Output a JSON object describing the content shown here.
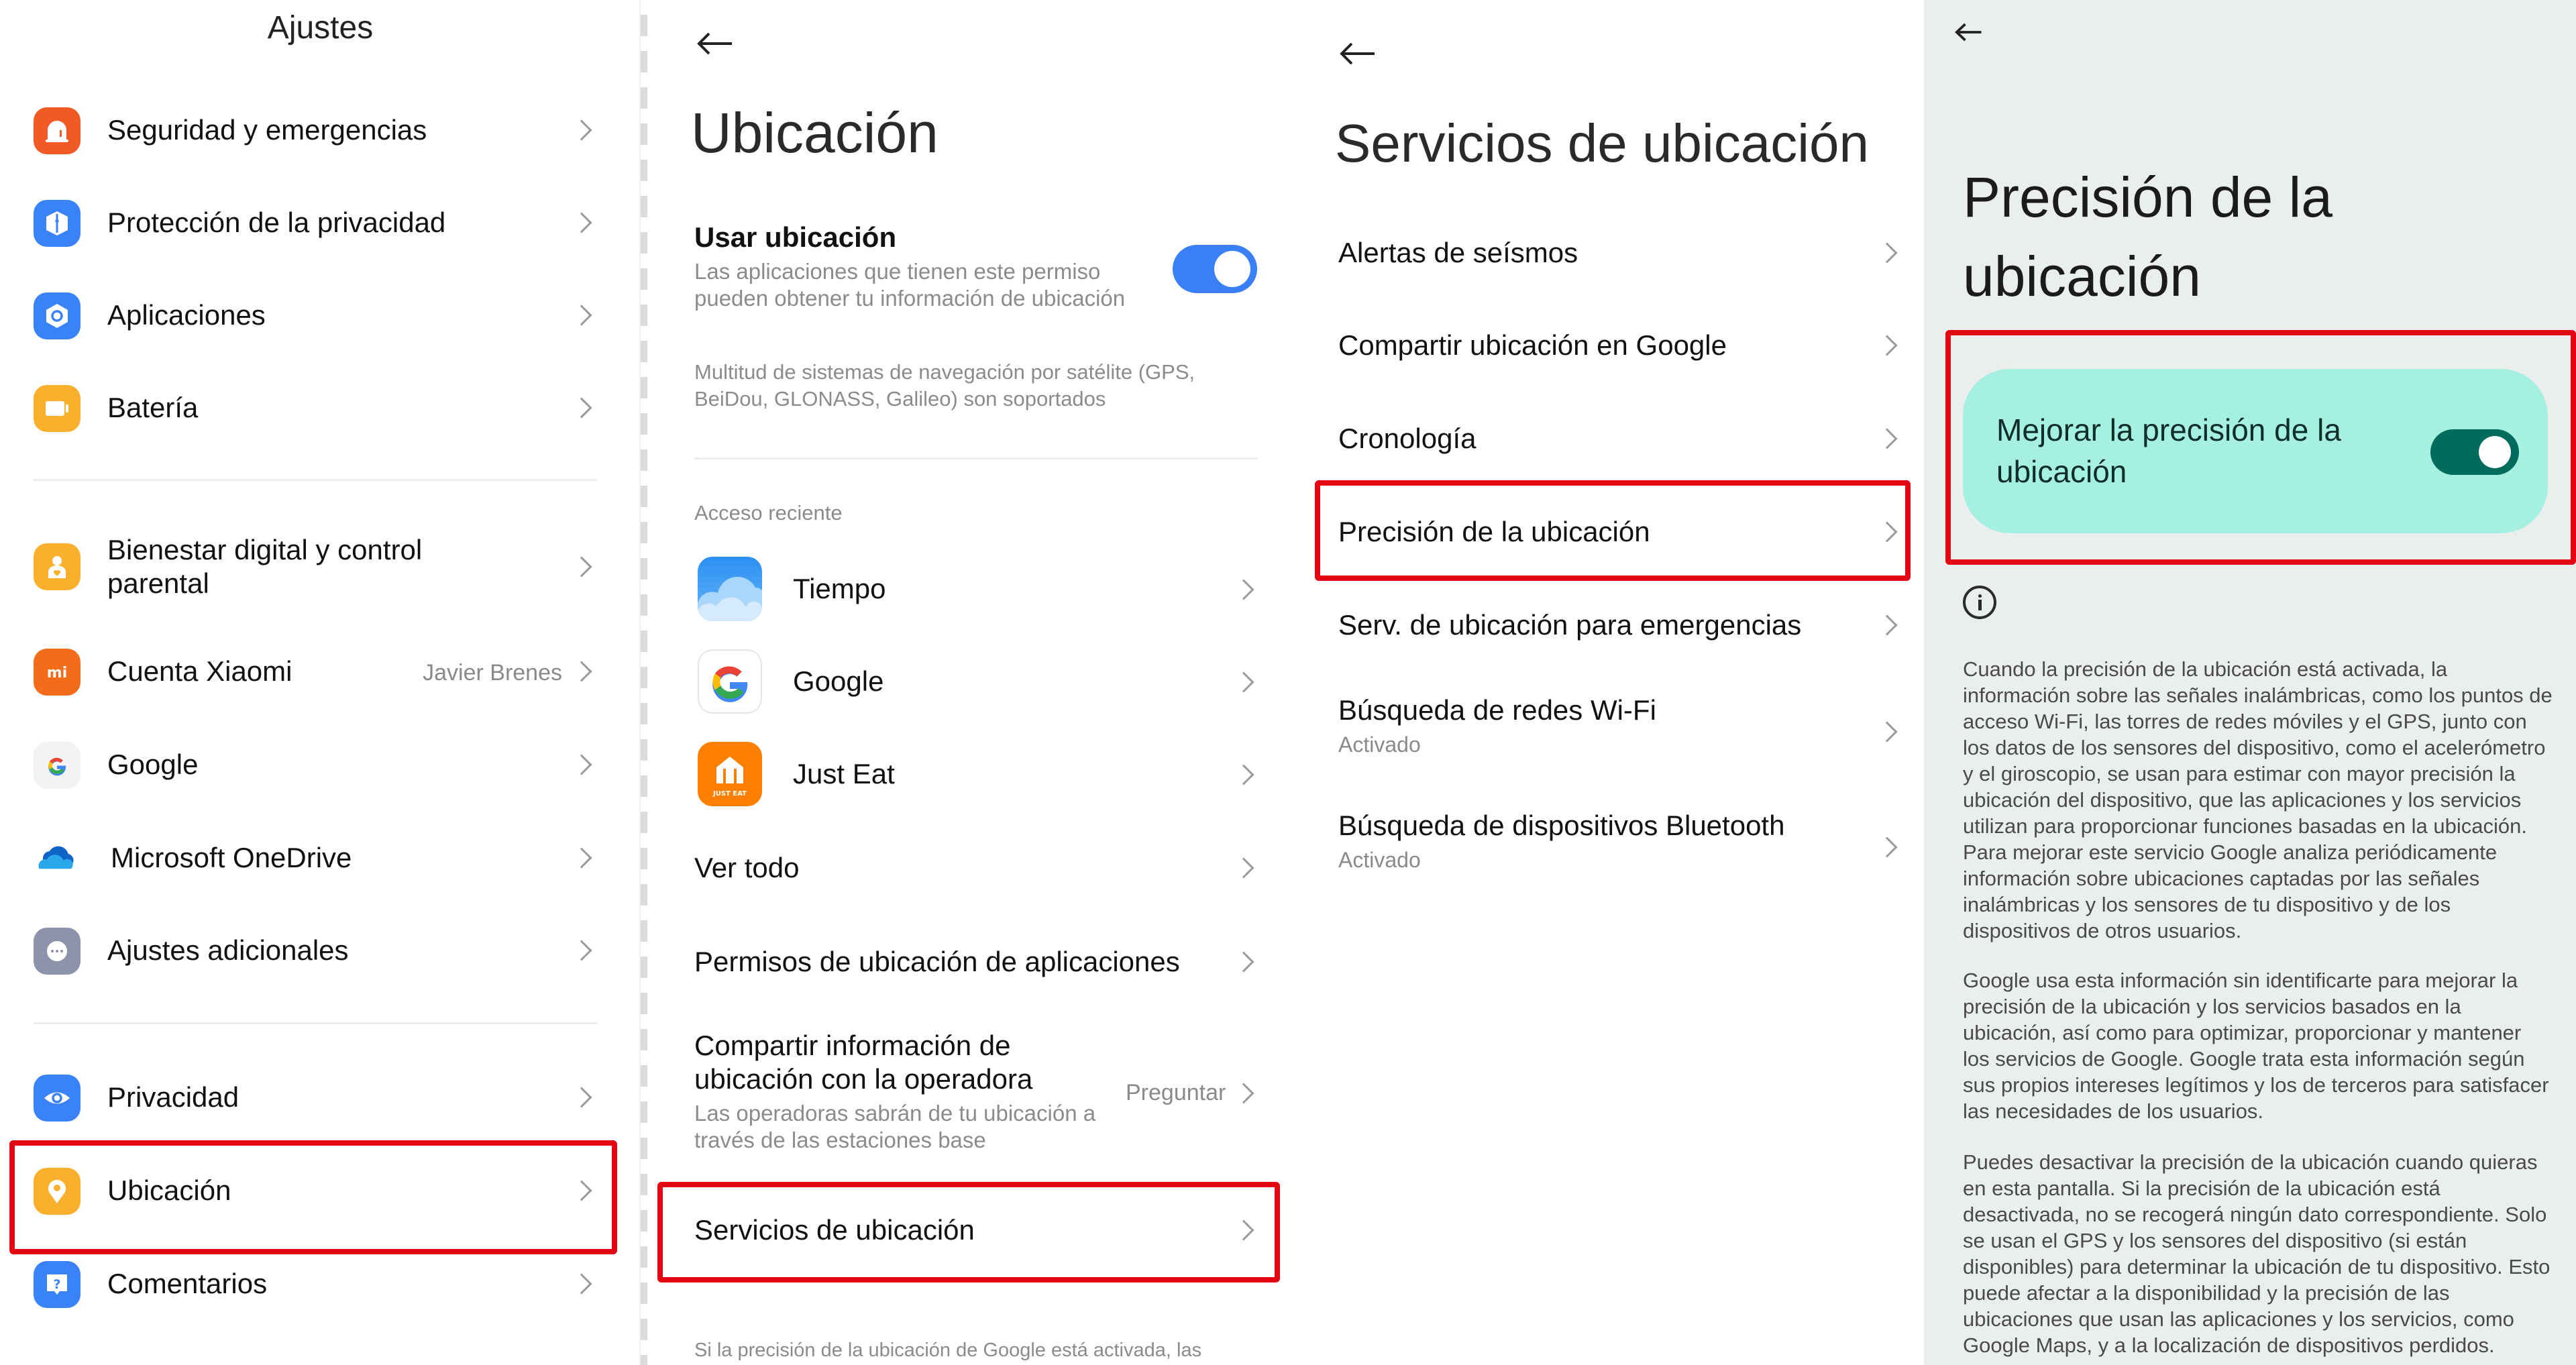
{
  "panels": {
    "settings": {
      "title": "Ajustes",
      "items": [
        {
          "label": "Seguridad y emergencias",
          "icon": "siren-icon",
          "color": "#f15a24"
        },
        {
          "label": "Protección de la privacidad",
          "icon": "privacy-shield-icon",
          "color": "#3a82f7"
        },
        {
          "label": "Aplicaciones",
          "icon": "apps-hexagon-icon",
          "color": "#3a82f7"
        },
        {
          "label": "Batería",
          "icon": "battery-icon",
          "color": "#fbb02d"
        },
        {
          "label": "Bienestar digital y control parental",
          "label_line1": "Bienestar digital y control",
          "label_line2": "parental",
          "icon": "wellbeing-icon",
          "color": "#fbb02d"
        },
        {
          "label": "Cuenta Xiaomi",
          "value": "Javier Brenes",
          "icon": "xiaomi-account-icon",
          "color": "#f26c1a"
        },
        {
          "label": "Google",
          "icon": "google-icon",
          "color": "#f3f3f3"
        },
        {
          "label": "Microsoft OneDrive",
          "icon": "onedrive-icon",
          "color": "#1e88e5"
        },
        {
          "label": "Ajustes adicionales",
          "icon": "more-dots-icon",
          "color": "#8d93ab"
        },
        {
          "label": "Privacidad",
          "icon": "eye-icon",
          "color": "#3a82f7"
        },
        {
          "label": "Ubicación",
          "icon": "location-pin-icon",
          "color": "#fbb02d",
          "highlighted": true
        },
        {
          "label": "Comentarios",
          "icon": "feedback-icon",
          "color": "#3a82f7"
        }
      ]
    },
    "location": {
      "back_icon": "back-arrow-icon",
      "title": "Ubicación",
      "use_location": {
        "label": "Usar ubicación",
        "description_line1": "Las aplicaciones que tienen este permiso",
        "description_line2": "pueden obtener tu información de ubicación",
        "enabled": true,
        "toggle_color": "#3a7ff6"
      },
      "gnss_note_line1": "Multitud de sistemas de navegación por satélite (GPS,",
      "gnss_note_line2": "BeiDou, GLONASS, Galileo) son soportados",
      "recent_access_header": "Acceso reciente",
      "recent_apps": [
        {
          "label": "Tiempo",
          "icon": "weather-app-icon"
        },
        {
          "label": "Google",
          "icon": "google-app-icon"
        },
        {
          "label": "Just Eat",
          "icon": "just-eat-app-icon",
          "icon_text": "JUST EAT"
        }
      ],
      "see_all": "Ver todo",
      "app_permissions": "Permisos de ubicación de aplicaciones",
      "carrier_share": {
        "label_line1": "Compartir información de",
        "label_line2": "ubicación con la operadora",
        "description_line1": "Las operadoras sabrán de tu ubicación a",
        "description_line2": "través de las estaciones base",
        "value": "Preguntar"
      },
      "location_services": {
        "label": "Servicios de ubicación",
        "highlighted": true
      },
      "footer_note": "Si la precisión de la ubicación de Google está activada, las"
    },
    "location_services": {
      "back_icon": "back-arrow-icon",
      "title": "Servicios de ubicación",
      "items": [
        {
          "label": "Alertas de seísmos"
        },
        {
          "label": "Compartir ubicación en Google"
        },
        {
          "label": "Cronología"
        },
        {
          "label": "Precisión de la ubicación",
          "highlighted": true
        },
        {
          "label": "Serv. de ubicación para emergencias"
        },
        {
          "label": "Búsqueda de redes Wi-Fi",
          "status": "Activado"
        },
        {
          "label": "Búsqueda de dispositivos Bluetooth",
          "status": "Activado"
        }
      ]
    },
    "location_accuracy": {
      "back_icon": "back-arrow-icon",
      "title_line1": "Precisión de la",
      "title_line2": "ubicación",
      "toggle": {
        "label_line1": "Mejorar la precisión de la",
        "label_line2": "ubicación",
        "enabled": true,
        "card_color": "#a6f0e1",
        "toggle_color": "#006c5b"
      },
      "info_icon": "info-icon",
      "paragraphs": [
        "Cuando la precisión de la ubicación está activada, la información sobre las señales inalámbricas, como los puntos de acceso Wi-Fi, las torres de redes móviles y el GPS, junto con los datos de los sensores del dispositivo, como el acelerómetro y el giroscopio, se usan para estimar con mayor precisión la ubicación del dispositivo, que las aplicaciones y los servicios utilizan para proporcionar funciones basadas en la ubicación. Para mejorar este servicio Google analiza periódicamente información sobre ubicaciones captadas por las señales inalámbricas y los sensores de tu dispositivo y de los dispositivos de otros usuarios.",
        "Google usa esta información sin identificarte para mejorar la precisión de la ubicación y los servicios basados en la ubicación, así como para optimizar, proporcionar y mantener los servicios de Google. Google trata esta información según sus propios intereses legítimos y los de terceros para satisfacer las necesidades de los usuarios.",
        "Puedes desactivar la precisión de la ubicación cuando quieras en esta pantalla. Si la precisión de la ubicación está desactivada, no se recogerá ningún dato correspondiente. Solo se usan el GPS y los sensores del dispositivo (si están disponibles) para determinar la ubicación de tu dispositivo. Esto puede afectar a la disponibilidad y la precisión de las ubicaciones que usan las aplicaciones y los servicios, como Google Maps, y a la localización de dispositivos perdidos."
      ]
    }
  },
  "colors": {
    "highlight_box": "#e30613",
    "accent_blue": "#3a7ff6",
    "accent_teal": "#006c5b",
    "panel4_background": "#eaefee"
  }
}
